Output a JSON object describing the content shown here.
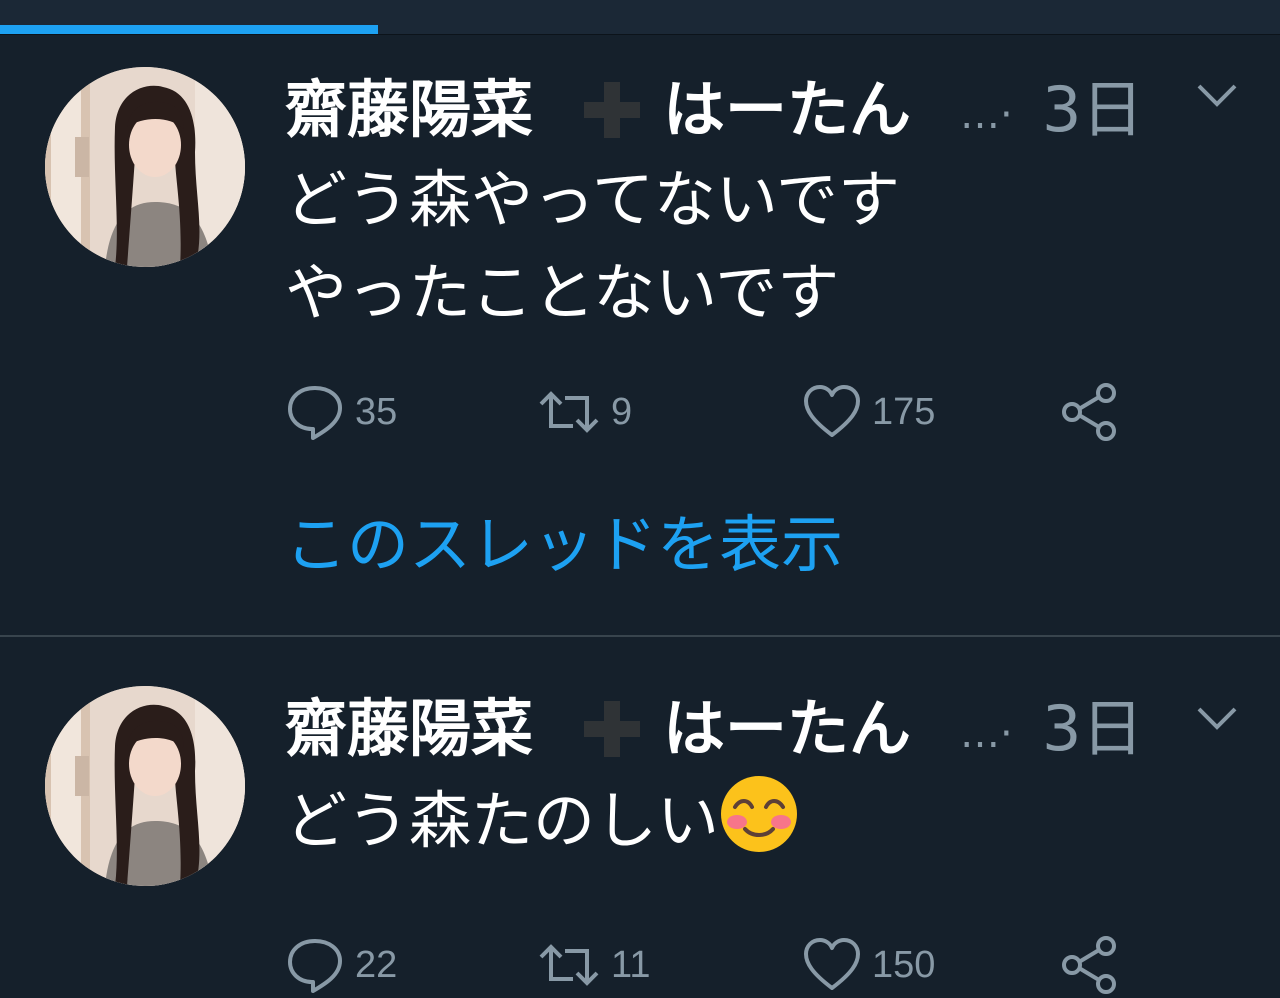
{
  "progress": {
    "fraction": 0.295
  },
  "tweets": [
    {
      "name": "齋藤陽菜",
      "name_emoji": "heavy-plus-icon",
      "name_suffix": "はーたん",
      "ellipsis": "…·",
      "time": "3日",
      "text_lines": [
        "どう森やってないです",
        "やったことないです"
      ],
      "reply_count": "35",
      "retweet_count": "9",
      "like_count": "175",
      "thread_link": "このスレッドを表示"
    },
    {
      "name": "齋藤陽菜",
      "name_emoji": "heavy-plus-icon",
      "name_suffix": "はーたん",
      "ellipsis": "…·",
      "time": "3日",
      "text": "どう森たのしい",
      "text_emoji": "smiling-face-with-smiling-eyes-icon",
      "reply_count": "22",
      "retweet_count": "11",
      "like_count": "150"
    }
  ],
  "colors": {
    "background": "#15202b",
    "accent": "#1da1f2",
    "secondary_text": "#8899a6",
    "divider": "#38444d"
  }
}
